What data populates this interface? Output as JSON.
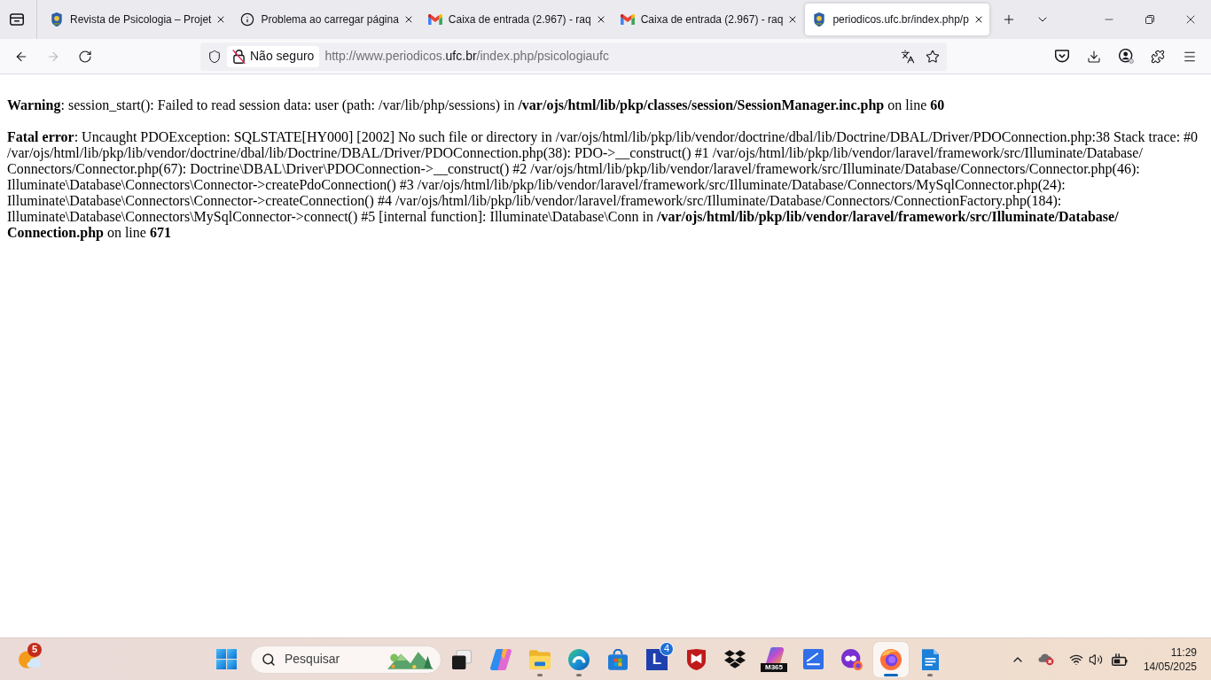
{
  "tabs": [
    {
      "title": "Revista de Psicologia – Projet",
      "kind": "journal",
      "selected": false
    },
    {
      "title": "Problema ao carregar página",
      "kind": "info",
      "selected": false
    },
    {
      "title": "Caixa de entrada (2.967) - raq",
      "kind": "gmail",
      "selected": false
    },
    {
      "title": "Caixa de entrada (2.967) - raq",
      "kind": "gmail",
      "selected": false
    },
    {
      "title": "periodicos.ufc.br/index.php/p",
      "kind": "journal",
      "selected": true
    }
  ],
  "nav": [
    {
      "kind": "back",
      "disabled": false
    },
    {
      "kind": "forward",
      "disabled": true
    },
    {
      "kind": "reload",
      "disabled": false
    }
  ],
  "address_bar": {
    "security_label": "Não seguro",
    "url": {
      "prefix": "http://www.periodicos.",
      "domain": "ufc.br",
      "path": "/index.php/psicologiaufc"
    }
  },
  "page": {
    "messages": [
      {
        "text": "**Warning**: session_start(): Failed to read session data: user (path: /var/lib/php/sessions) in **/var/ojs/html/lib/pkp/classes/session/SessionManager.inc.php** on line **60**"
      },
      {
        "text": "**Fatal error**: Uncaught PDOException: SQLSTATE[HY000] [2002] No such file or directory in /var/ojs/html/lib/pkp/lib/vendor/doctrine/dbal/lib/Doctrine/DBAL/Driver/PDOConnection.php:38 Stack trace: #0 /var/ojs/html/lib/pkp/lib/vendor/doctrine/dbal/lib/Doctrine/DBAL/Driver/PDOConnection.php(38): PDO->__construct() #1 /var/ojs/html/lib/pkp/lib/vendor/laravel/framework/src/Illuminate/Database/Connectors/Connector.php(67): Doctrine\\DBAL\\Driver\\PDOConnection->__construct() #2 /var/ojs/html/lib/pkp/lib/vendor/laravel/framework/src/Illuminate/Database/Connectors/Connector.php(46): Illuminate\\Database\\Connectors\\Connector->createPdoConnection() #3 /var/ojs/html/lib/pkp/lib/vendor/laravel/framework/src/Illuminate/Database/Connectors/MySqlConnector.php(24): Illuminate\\Database\\Connectors\\Connector->createConnection() #4 /var/ojs/html/lib/pkp/lib/vendor/laravel/framework/src/Illuminate/Database/Connectors/ConnectionFactory.php(184): Illuminate\\Database\\Connectors\\MySqlConnector->connect() #5 [internal function]: Illuminate\\Database\\Conn in **/var/ojs/html/lib/pkp/lib/vendor/laravel/framework/src/Illuminate/Database/Connection.php** on line **671**"
      }
    ]
  },
  "taskbar": {
    "weather": {
      "badge": "5"
    },
    "search": {
      "placeholder": "Pesquisar"
    },
    "apps": [
      {
        "kind": "task-view",
        "running": false,
        "active": false
      },
      {
        "kind": "copilot",
        "running": false,
        "active": false
      },
      {
        "kind": "explorer",
        "running": true,
        "active": false
      },
      {
        "kind": "edge",
        "running": true,
        "active": false
      },
      {
        "kind": "store",
        "running": false,
        "active": false
      },
      {
        "kind": "letter",
        "logo_text": "L",
        "badge": "4",
        "running": false,
        "active": false
      },
      {
        "kind": "mcafee",
        "running": false,
        "active": false
      },
      {
        "kind": "dropbox",
        "running": false,
        "active": false
      },
      {
        "kind": "m365",
        "logo_text": "M365",
        "running": false,
        "active": false
      },
      {
        "kind": "scanner",
        "running": false,
        "active": false
      },
      {
        "kind": "privacy",
        "running": false,
        "active": false
      },
      {
        "kind": "firefox",
        "running": true,
        "active": true
      },
      {
        "kind": "writer",
        "running": true,
        "active": false
      }
    ],
    "clock": {
      "time": "11:29",
      "date": "14/05/2025"
    }
  }
}
